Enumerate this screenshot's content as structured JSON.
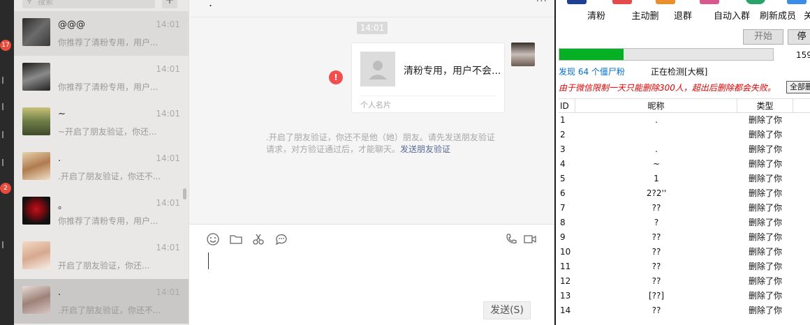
{
  "leftbar": {
    "badge1": "17",
    "badge2": "2"
  },
  "chatlist": {
    "search_placeholder": "搜索",
    "items": [
      {
        "name": "@@@",
        "time": "14:01",
        "msg": "你推荐了清粉专用，用户..."
      },
      {
        "name": "",
        "time": "14:01",
        "msg": "你推荐了清粉专用，用户..."
      },
      {
        "name": "~",
        "time": "14:01",
        "msg": "~开启了朋友验证，你还..."
      },
      {
        "name": ".",
        "time": "14:01",
        "msg": ".开启了朋友验证，你还不..."
      },
      {
        "name": "。",
        "time": "14:01",
        "msg": "你推荐了清粉专用，用户..."
      },
      {
        "name": "",
        "time": "14:01",
        "msg": "开启了朋友验证，你还..."
      },
      {
        "name": ".",
        "time": "14:01",
        "msg": ".开启了朋友验证，你还不..."
      }
    ]
  },
  "chat": {
    "title": ".",
    "more": "···",
    "timestamp": "14:01",
    "card_name": "清粉专用，用户不会...",
    "card_footer": "个人名片",
    "error_mark": "!",
    "notice": ".开启了朋友验证，你还不是他（她）朋友。请先发送朋友验证请求，对方验证通过后，才能聊天。",
    "notice_link": "发送朋友验证",
    "send_label": "发送(S)"
  },
  "tool": {
    "buttons": [
      "清粉",
      "主动删",
      "退群",
      "自动入群",
      "刷新成员",
      "关闭"
    ],
    "start_label": "开始",
    "stop_label": "停",
    "progress_fraction": 0.3,
    "progress_count": "159",
    "found_text": "发现 64 个僵尸粉",
    "detect_text": "正在检测[大概]",
    "warning": "由于微信限制一天只能删除300人，超出后删除都会失败。",
    "all_btn": "全部删",
    "table": {
      "headers": [
        "ID",
        "昵称",
        "类型"
      ],
      "rows": [
        {
          "id": "1",
          "nick": ".",
          "type": "删除了你"
        },
        {
          "id": "2",
          "nick": "",
          "type": "删除了你"
        },
        {
          "id": "3",
          "nick": ".",
          "type": "删除了你"
        },
        {
          "id": "4",
          "nick": "~",
          "type": "删除了你"
        },
        {
          "id": "5",
          "nick": "1",
          "type": "删除了你"
        },
        {
          "id": "6",
          "nick": "2?2''",
          "type": "删除了你"
        },
        {
          "id": "7",
          "nick": "??",
          "type": "删除了你"
        },
        {
          "id": "8",
          "nick": "?",
          "type": "删除了你"
        },
        {
          "id": "9",
          "nick": "??",
          "type": "删除了你"
        },
        {
          "id": "10",
          "nick": "??",
          "type": "删除了你"
        },
        {
          "id": "11",
          "nick": "??",
          "type": "删除了你"
        },
        {
          "id": "12",
          "nick": "??",
          "type": "删除了你"
        },
        {
          "id": "13",
          "nick": "[??]",
          "type": "删除了你"
        },
        {
          "id": "14",
          "nick": "??",
          "type": "删除了你"
        }
      ]
    }
  }
}
